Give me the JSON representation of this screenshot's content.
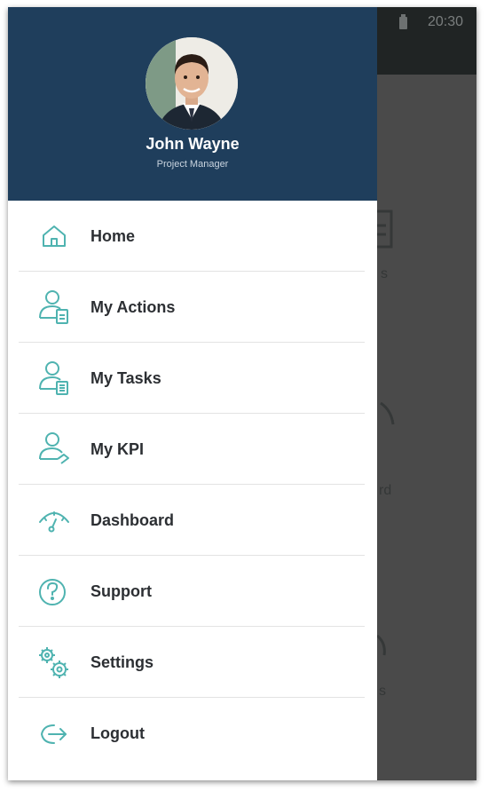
{
  "status_bar": {
    "time": "20:30"
  },
  "background_labels": {
    "label_1": "s",
    "label_2": "rd",
    "label_3": "s"
  },
  "profile": {
    "name": "John Wayne",
    "role": "Project Manager"
  },
  "menu": {
    "items": [
      {
        "label": "Home",
        "icon": "home-icon"
      },
      {
        "label": "My Actions",
        "icon": "user-clipboard-icon"
      },
      {
        "label": "My Tasks",
        "icon": "user-list-icon"
      },
      {
        "label": "My KPI",
        "icon": "user-chart-icon"
      },
      {
        "label": "Dashboard",
        "icon": "gauge-icon"
      },
      {
        "label": "Support",
        "icon": "question-icon"
      },
      {
        "label": "Settings",
        "icon": "gears-icon"
      },
      {
        "label": "Logout",
        "icon": "logout-icon"
      }
    ]
  },
  "colors": {
    "header": "#1f3e5c",
    "icon_teal": "#4fb3b0",
    "label_text": "#2c2f33",
    "scrim": "#4a4a4a"
  }
}
